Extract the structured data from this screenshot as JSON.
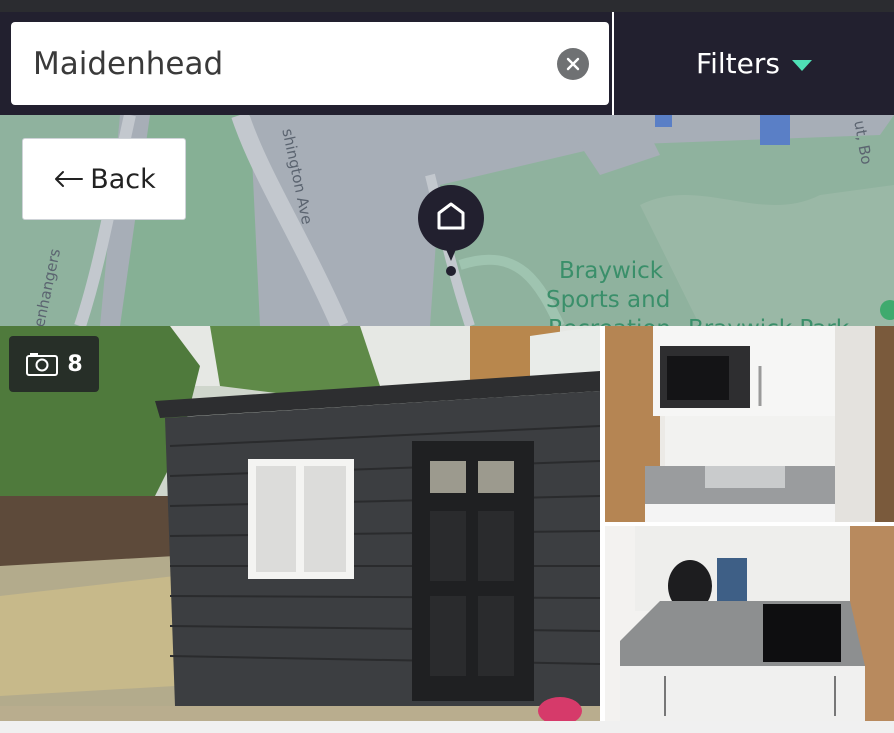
{
  "search": {
    "value": "Maidenhead",
    "clear_icon": "close-icon"
  },
  "filters": {
    "label": "Filters",
    "accent": "#4fe0b6"
  },
  "map": {
    "back_label": "Back",
    "place_label_lines": [
      "Braywick",
      "Sports and",
      "Recreation",
      "Braywick Park"
    ],
    "streets": [
      "shington Ave",
      "enhangers",
      "ut, Bo"
    ],
    "pin_icon": "home-icon"
  },
  "gallery": {
    "photo_count": "8",
    "photos": [
      "shed exterior",
      "kitchenette microwave and sink",
      "kitchenette hob and kettle"
    ]
  }
}
